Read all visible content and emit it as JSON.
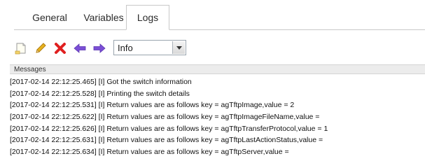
{
  "tabs": [
    {
      "label": "General"
    },
    {
      "label": "Variables"
    },
    {
      "label": "Logs"
    }
  ],
  "toolbar": {
    "level_select": {
      "value": "Info"
    }
  },
  "messages": {
    "header": "Messages",
    "lines": [
      "[2017-02-14 22:12:25.465] [I] Got the switch information",
      "[2017-02-14 22:12:25.528] [I] Printing the switch details",
      "[2017-02-14 22:12:25.531] [I] Return values are as follows key = agTftpImage,value = 2",
      "[2017-02-14 22:12:25.622] [I] Return values are as follows key = agTftpImageFileName,value =",
      "[2017-02-14 22:12:25.626] [I] Return values are as follows key = agTftpTransferProtocol,value = 1",
      "[2017-02-14 22:12:25.631] [I] Return values are as follows key = agTftpLastActionStatus,value =",
      "[2017-02-14 22:12:25.634] [I] Return values are as follows key = agTftpServer,value ="
    ]
  },
  "colors": {
    "delete": "#e02020",
    "arrows": "#7b4fd6",
    "edit": "#e8b320"
  }
}
